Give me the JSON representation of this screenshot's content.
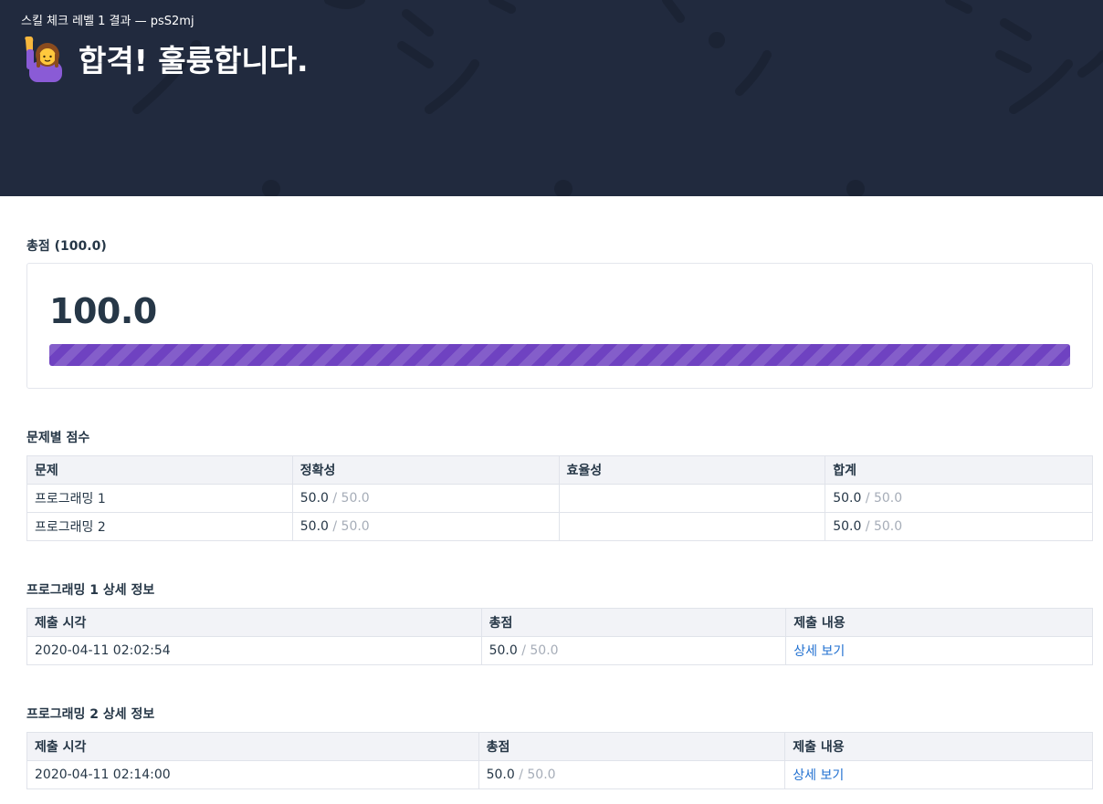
{
  "header": {
    "subtitle": "스킬 체크 레벨 1 결과 — psS2mj",
    "title": "합격! 훌륭합니다.",
    "emoji_icon": "person-raising-hand-icon"
  },
  "total": {
    "section_title": "총점 (100.0)",
    "score": "100.0",
    "progress_fraction": 1.0,
    "bar_color": "#6f42c1"
  },
  "problems": {
    "section_title": "문제별 점수",
    "headers": [
      "문제",
      "정확성",
      "효율성",
      "합계"
    ],
    "rows": [
      {
        "name": "프로그래밍 1",
        "accuracy": "50.0",
        "accuracy_max": " / 50.0",
        "efficiency": "",
        "sum": "50.0",
        "sum_max": " / 50.0"
      },
      {
        "name": "프로그래밍 2",
        "accuracy": "50.0",
        "accuracy_max": " / 50.0",
        "efficiency": "",
        "sum": "50.0",
        "sum_max": " / 50.0"
      }
    ]
  },
  "details": [
    {
      "section_title": "프로그래밍 1 상세 정보",
      "headers": [
        "제출 시각",
        "총점",
        "제출 내용"
      ],
      "row": {
        "time": "2020-04-11 02:02:54",
        "score": "50.0",
        "score_max": " / 50.0",
        "link": "상세 보기"
      }
    },
    {
      "section_title": "프로그래밍 2 상세 정보",
      "headers": [
        "제출 시각",
        "총점",
        "제출 내용"
      ],
      "row": {
        "time": "2020-04-11 02:14:00",
        "score": "50.0",
        "score_max": " / 50.0",
        "link": "상세 보기"
      }
    }
  ],
  "colors": {
    "header_bg": "#212a3e",
    "link": "#1f6fd0",
    "muted": "#a6adb8"
  }
}
